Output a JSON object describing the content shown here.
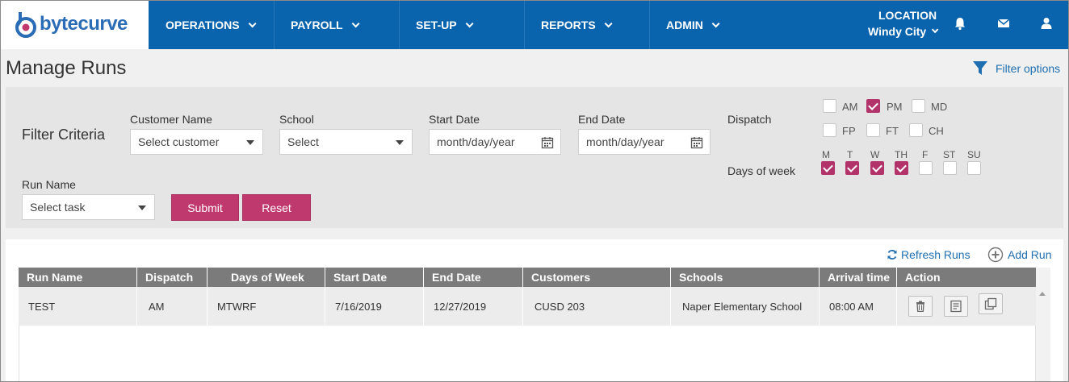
{
  "brand": {
    "name": "bytecurve",
    "accent": "#0a64ad",
    "button_color": "#c0396e"
  },
  "nav": {
    "items": [
      {
        "label": "OPERATIONS"
      },
      {
        "label": "PAYROLL"
      },
      {
        "label": "SET-UP"
      },
      {
        "label": "REPORTS"
      },
      {
        "label": "ADMIN"
      }
    ],
    "location_label": "LOCATION",
    "location_value": "Windy City",
    "icons": [
      "bell-icon",
      "envelope-icon",
      "user-icon"
    ]
  },
  "page": {
    "title": "Manage Runs",
    "filter_options_label": "Filter options"
  },
  "filter": {
    "title": "Filter Criteria",
    "customer_label": "Customer Name",
    "customer_value": "Select customer",
    "school_label": "School",
    "school_value": "Select",
    "start_label": "Start Date",
    "start_value": "month/day/year",
    "end_label": "End Date",
    "end_value": "month/day/year",
    "run_label": "Run Name",
    "run_value": "Select task",
    "submit_label": "Submit",
    "reset_label": "Reset",
    "dispatch_label": "Dispatch",
    "dispatch": [
      {
        "label": "AM",
        "checked": false
      },
      {
        "label": "PM",
        "checked": true
      },
      {
        "label": "MD",
        "checked": false
      },
      {
        "label": "FP",
        "checked": false
      },
      {
        "label": "FT",
        "checked": false
      },
      {
        "label": "CH",
        "checked": false
      }
    ],
    "days_label": "Days of week",
    "days": [
      {
        "label": "M",
        "checked": true
      },
      {
        "label": "T",
        "checked": true
      },
      {
        "label": "W",
        "checked": true
      },
      {
        "label": "TH",
        "checked": true
      },
      {
        "label": "F",
        "checked": false
      },
      {
        "label": "ST",
        "checked": false
      },
      {
        "label": "SU",
        "checked": false
      }
    ]
  },
  "table": {
    "refresh_label": "Refresh Runs",
    "add_label": "Add Run",
    "columns": [
      "Run Name",
      "Dispatch",
      "Days of Week",
      "Start Date",
      "End Date",
      "Customers",
      "Schools",
      "Arrival time",
      "Action"
    ],
    "rows": [
      {
        "run_name": "TEST",
        "dispatch": "AM",
        "days": "MTWRF",
        "start": "7/16/2019",
        "end": "12/27/2019",
        "customers": "CUSD 203",
        "schools": "Naper Elementary School",
        "arrival": "08:00 AM"
      }
    ]
  }
}
